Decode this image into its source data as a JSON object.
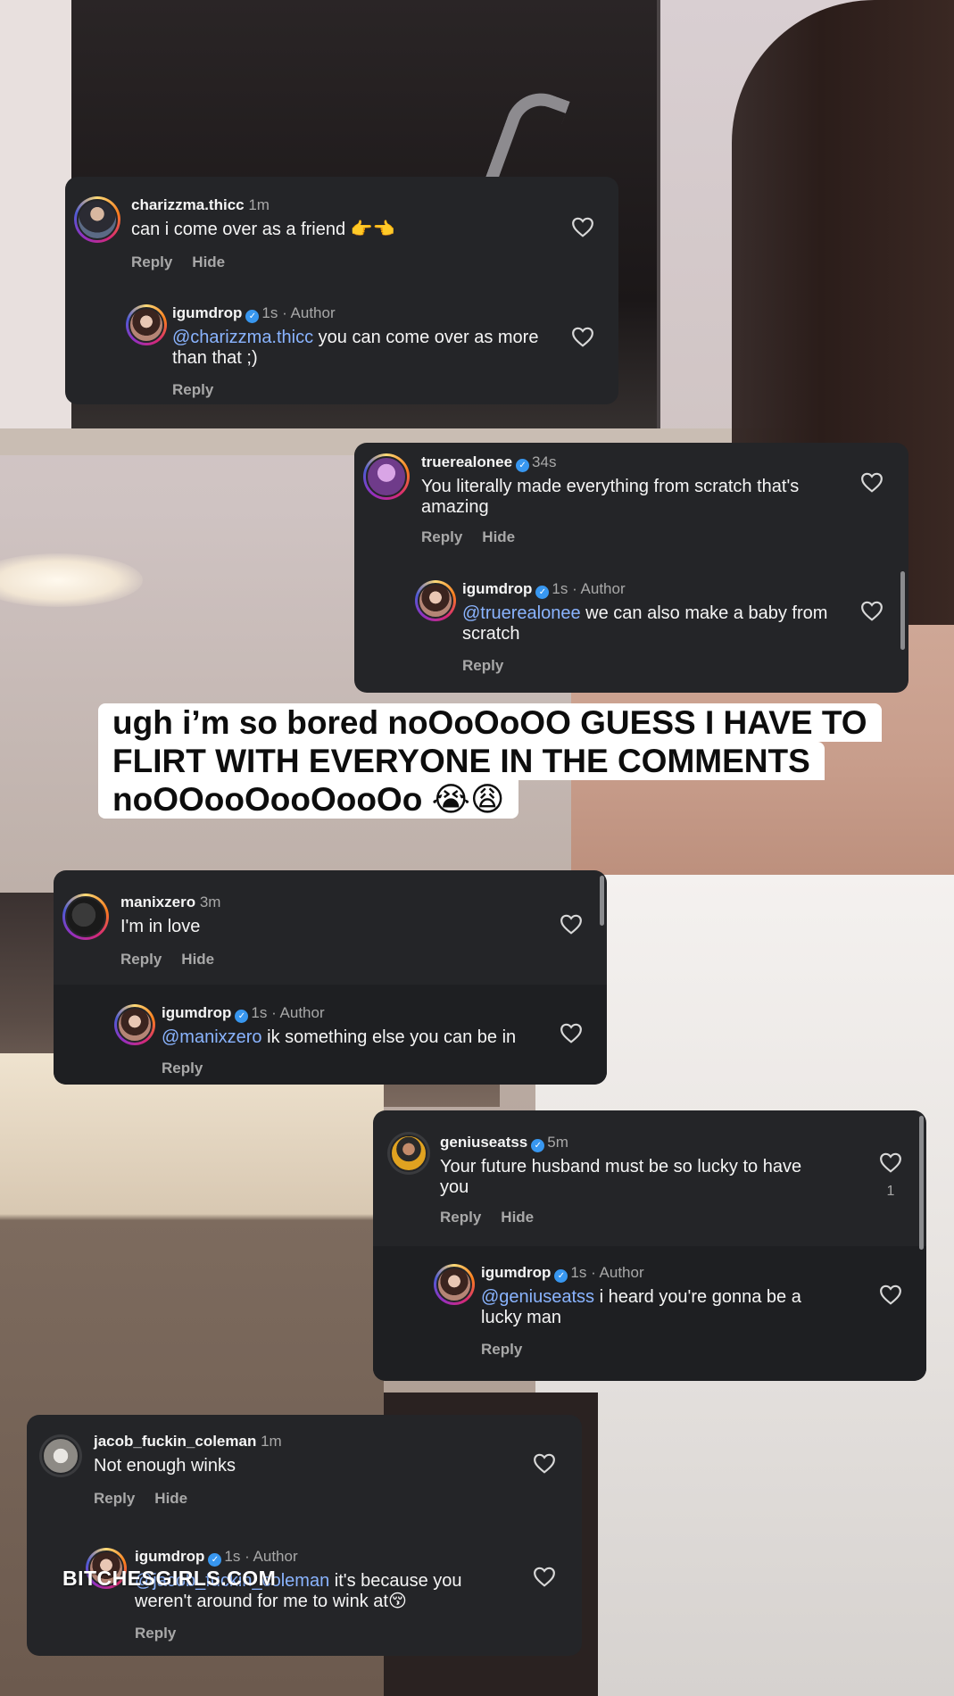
{
  "caption": {
    "line1": "ugh i’m so bored noOoOoOO GUESS I HAVE TO",
    "line2": "FLIRT WITH EVERYONE IN THE COMMENTS",
    "line3_text": "noOOooOooOooOo",
    "line3_emoji": "😭😩"
  },
  "labels": {
    "reply": "Reply",
    "hide": "Hide",
    "author": "· Author"
  },
  "threads": [
    {
      "comment": {
        "user": "charizzma.thicc",
        "time": "1m",
        "text": "can i come over as a friend 👉👈"
      },
      "reply": {
        "user": "igumdrop",
        "time": "1s",
        "mention": "@charizzma.thicc",
        "text": " you can come over as more than that ;)"
      }
    },
    {
      "comment": {
        "user": "truerealonee",
        "time": "34s",
        "text": "You literally made everything from scratch that's amazing"
      },
      "reply": {
        "user": "igumdrop",
        "time": "1s",
        "mention": "@truerealonee",
        "text": " we can also make a baby from scratch"
      }
    },
    {
      "comment": {
        "user": "manixzero",
        "time": "3m",
        "text": "I'm in love"
      },
      "reply": {
        "user": "igumdrop",
        "time": "1s",
        "mention": "@manixzero",
        "text": " ik something else you can be in"
      }
    },
    {
      "comment": {
        "user": "geniuseatss",
        "time": "5m",
        "text": "Your future husband must be so lucky to have you",
        "likes": "1"
      },
      "reply": {
        "user": "igumdrop",
        "time": "1s",
        "mention": "@geniuseatss",
        "text": " i heard you're gonna be a lucky man"
      }
    },
    {
      "comment": {
        "user": "jacob_fuckin_coleman",
        "time": "1m",
        "text": "Not enough winks"
      },
      "reply": {
        "user": "igumdrop",
        "time": "1s",
        "mention": "@jacob_fuckin_coleman",
        "text": " it's because you weren't around for me to wink at😚"
      }
    }
  ],
  "watermark": "BITCHESGIRLS.COM",
  "colors": {
    "card": "#242528",
    "mention": "#8ab4ff",
    "verified": "#3897f0",
    "muted": "#a8a8a8"
  },
  "icons": [
    "heart-icon",
    "verified-badge-icon"
  ]
}
